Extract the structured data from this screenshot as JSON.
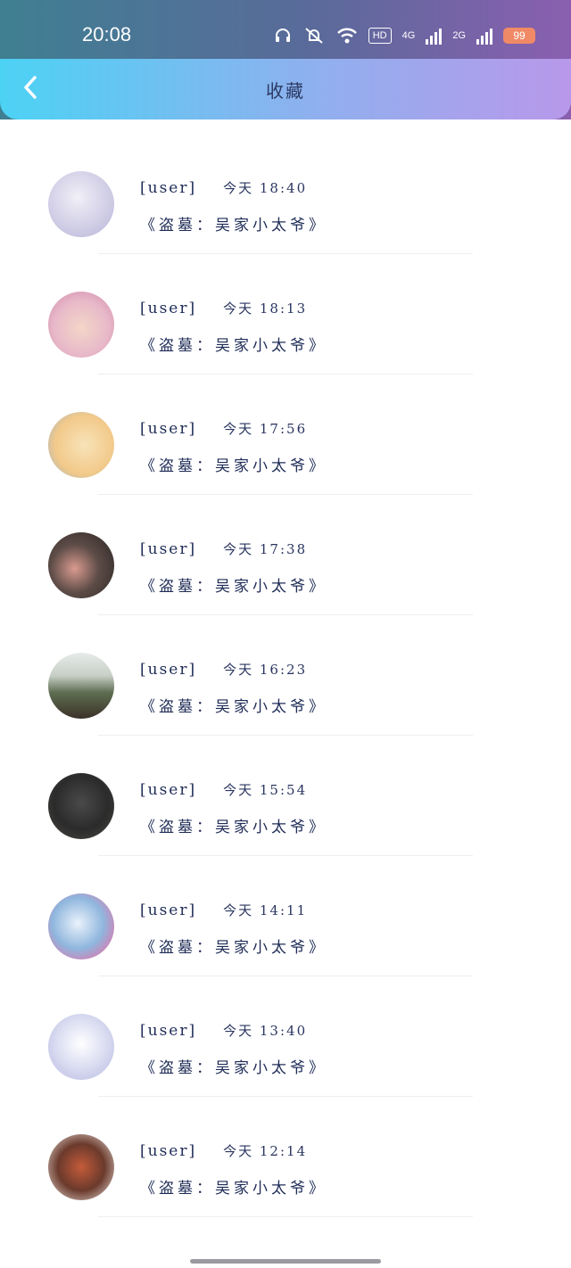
{
  "status_bar": {
    "time": "20:08",
    "hd": "HD",
    "net1": "4G",
    "net2": "2G",
    "battery": "99"
  },
  "header": {
    "title": "收藏",
    "back_icon": "chevron-left-icon"
  },
  "items": [
    {
      "username": "[user]",
      "time": "今天 18:40",
      "title": "《盗墓：吴家小太爷》",
      "avatar_color": "#c9c6e2"
    },
    {
      "username": "[user]",
      "time": "今天 18:13",
      "title": "《盗墓：吴家小太爷》",
      "avatar_color": "#e8b9c9"
    },
    {
      "username": "[user]",
      "time": "今天 17:56",
      "title": "《盗墓：吴家小太爷》",
      "avatar_color": "#f2c98a"
    },
    {
      "username": "[user]",
      "time": "今天 17:38",
      "title": "《盗墓：吴家小太爷》",
      "avatar_color": "#3b3533"
    },
    {
      "username": "[user]",
      "time": "今天 16:23",
      "title": "《盗墓：吴家小太爷》",
      "avatar_color": "#6f7f64"
    },
    {
      "username": "[user]",
      "time": "今天 15:54",
      "title": "《盗墓：吴家小太爷》",
      "avatar_color": "#2e2e2e"
    },
    {
      "username": "[user]",
      "time": "今天 14:11",
      "title": "《盗墓：吴家小太爷》",
      "avatar_color": "#8fb6dd"
    },
    {
      "username": "[user]",
      "time": "今天 13:40",
      "title": "《盗墓：吴家小太爷》",
      "avatar_color": "#d7d9f0"
    },
    {
      "username": "[user]",
      "time": "今天 12:14",
      "title": "《盗墓：吴家小太爷》",
      "avatar_color": "#6b3a2c"
    }
  ]
}
